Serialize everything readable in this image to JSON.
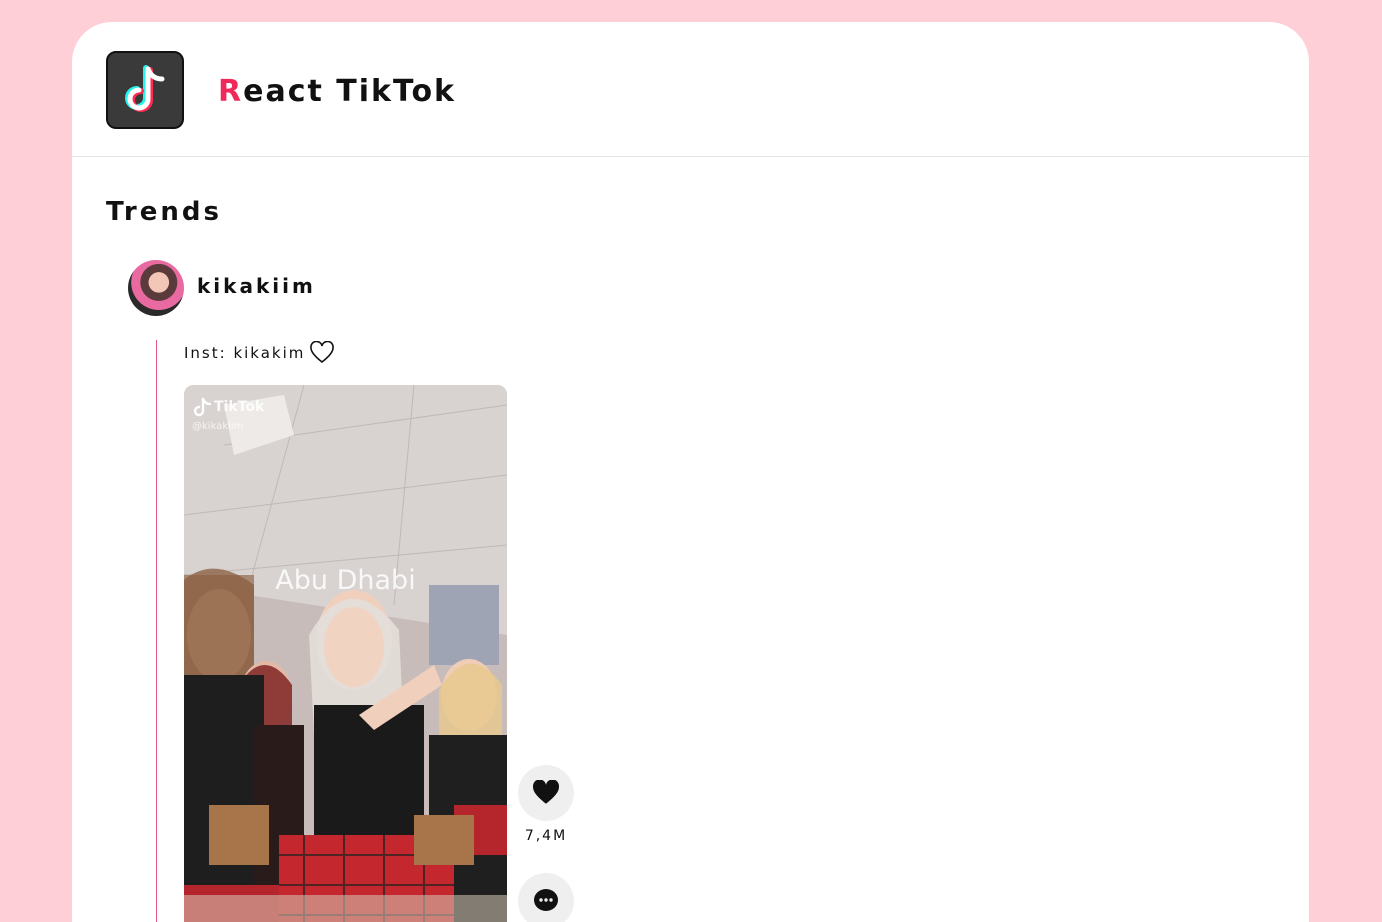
{
  "app": {
    "title_first_letter": "R",
    "title_rest": "eact TikTok",
    "logo_icon": "tiktok-logo-icon"
  },
  "section": {
    "title": "Trends"
  },
  "post": {
    "username": "kikakiim",
    "caption": "Inst: kikakim",
    "video": {
      "overlay_brand": "TikTok",
      "overlay_handle": "@kikakiim",
      "overlay_location": "Abu Dhabi"
    },
    "likes": "7,4M"
  },
  "colors": {
    "background": "#ffcfd8",
    "accent": "#ef2a5a",
    "thread_line": "#e35a84"
  }
}
